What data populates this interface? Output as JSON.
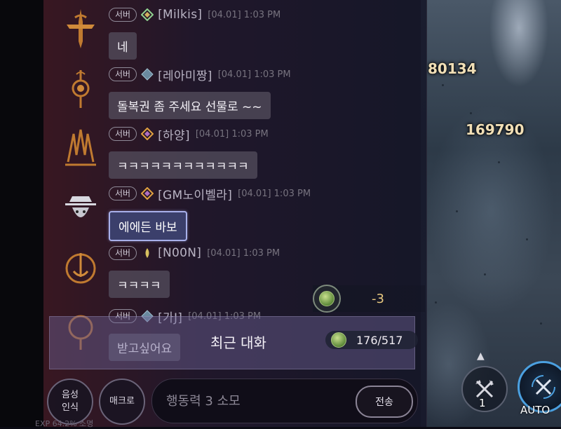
{
  "world": {
    "damage_numbers": [
      "80134",
      "169790"
    ]
  },
  "chat": {
    "messages": [
      {
        "server": "서버",
        "name": "[Milkis]",
        "time": "[04.01] 1:03 PM",
        "text": "네",
        "gm": false
      },
      {
        "server": "서버",
        "name": "[레아미짱]",
        "time": "[04.01] 1:03 PM",
        "text": "돌복권 좀 주세요 선물로 ~~",
        "gm": false
      },
      {
        "server": "서버",
        "name": "[하양]",
        "time": "[04.01] 1:03 PM",
        "text": "ㅋㅋㅋㅋㅋㅋㅋㅋㅋㅋㅋㅋ",
        "gm": false
      },
      {
        "server": "서버",
        "name": "[GM노이벨라]",
        "time": "[04.01] 1:03 PM",
        "text": "에에든 바보",
        "gm": true
      },
      {
        "server": "서버",
        "name": "[N00N]",
        "time": "[04.01] 1:03 PM",
        "text": "ㅋㅋㅋㅋ",
        "gm": false
      },
      {
        "server": "서버",
        "name": "[가J]",
        "time": "[04.01] 1:03 PM",
        "text": "받고싶어요",
        "gm": false
      }
    ],
    "recent_label": "최근 대화",
    "stamina_counter": "176/517",
    "stamina_delta": "-3"
  },
  "controls": {
    "voice_label_line1": "음성",
    "voice_label_line2": "인식",
    "macro_label": "매크로",
    "input_placeholder": "행동력 3 소모",
    "send_label": "전송",
    "bottom_left_text": "EXP 64.2%   소명"
  },
  "hud": {
    "skill_count": "1",
    "auto_label": "AUTO"
  },
  "colors": {
    "gm_bubble_border": "#a8b0ea",
    "auto_ring": "#4ba0e0",
    "delta_text": "#e8c880"
  },
  "icons": {
    "avatars": [
      "sword-emblem-icon",
      "orb-totem-icon",
      "claw-emblem-icon",
      "gm-hat-icon",
      "sun-emblem-icon",
      "ring-emblem-icon"
    ],
    "skill": "crossed-axes-icon",
    "auto": "crossed-swords-cycle-icon",
    "stamina": "green-gem-icon"
  }
}
